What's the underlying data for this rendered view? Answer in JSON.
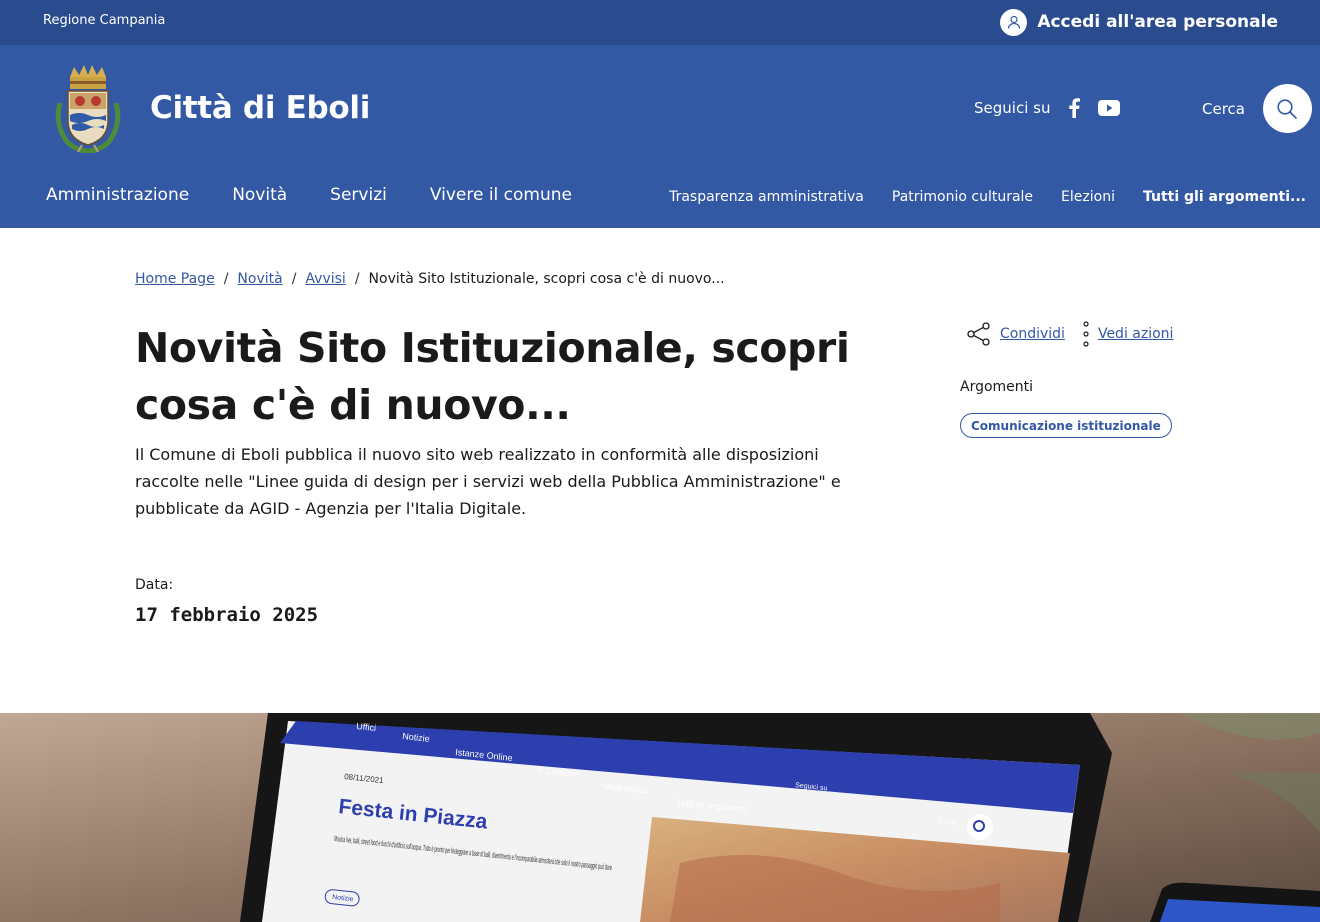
{
  "topbar": {
    "region": "Regione Campania",
    "login": "Accedi all'area personale"
  },
  "header": {
    "site_name": "Città di Eboli",
    "follow_label": "Seguici su",
    "search_label": "Cerca",
    "icons": [
      "user-icon",
      "facebook-icon",
      "youtube-icon",
      "search-icon",
      "share-icon",
      "more-vertical-icon"
    ]
  },
  "nav": {
    "main": [
      "Amministrazione",
      "Novità",
      "Servizi",
      "Vivere il comune"
    ],
    "secondary": [
      "Trasparenza amministrativa",
      "Patrimonio culturale",
      "Elezioni",
      "Tutti gli argomenti..."
    ]
  },
  "breadcrumb": {
    "items": [
      "Home Page",
      "Novità",
      "Avvisi"
    ],
    "current": "Novità Sito Istituzionale, scopri cosa c'è di nuovo..."
  },
  "article": {
    "title": "Novità Sito Istituzionale, scopri cosa c'è di nuovo...",
    "lead": "Il Comune di Eboli pubblica il nuovo sito web realizzato in conformità alle disposizioni raccolte nelle \"Linee guida di design per i servizi web della Pubblica Amministrazione\" e pubblicate da AGID - Agenzia per l'Italia Digitale.",
    "date_label": "Data:",
    "date_value": "17 febbraio 2025"
  },
  "sidebar": {
    "share": "Condividi",
    "actions": "Vedi azioni",
    "topics_label": "Argomenti",
    "topic": "Comunicazione istituzionale"
  },
  "hero_mock": {
    "nav": [
      "Uffici",
      "Notizie",
      "Istanze Online",
      "Il Comune",
      "Modulistica",
      "Tutti gli argomenti..."
    ],
    "date": "08/11/2021",
    "headline": "Festa in Piazza",
    "body": "Musica live, balli, street food e fuochi d'artificio sull'acqua. Tutto è pronto per festeggiare a base di balli, divertimento e l'incomparabile atmosfera che solo il nostro passaggio può dare.",
    "tag": "Notizie",
    "follow": "Seguici su",
    "search": "Cerca"
  },
  "colors": {
    "topbar": "#2b4b8f",
    "header": "#3358a4",
    "link": "#3358a4",
    "text": "#1a1a1a"
  }
}
